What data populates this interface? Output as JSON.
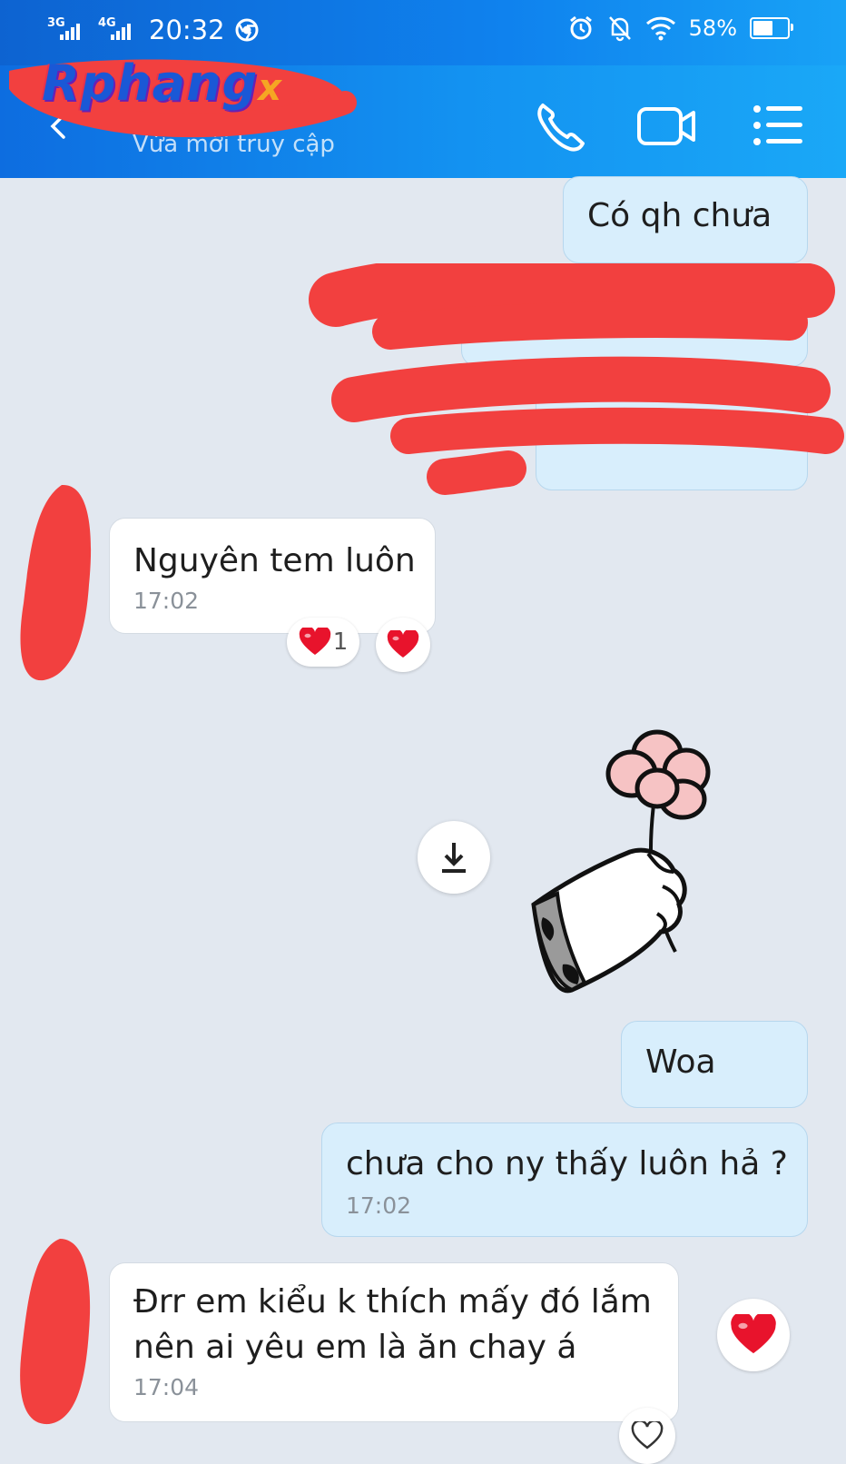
{
  "status_bar": {
    "sim1": "3G",
    "sim2": "4G",
    "time": "20:32",
    "battery_percent": "58%",
    "battery_level": 0.58
  },
  "header": {
    "contact_status": "Vừa mới truy cập",
    "brand_watermark": "Rphang",
    "brand_watermark_x": "x",
    "icons": [
      "back-icon",
      "phone-icon",
      "video-call-icon",
      "menu-icon"
    ]
  },
  "messages": [
    {
      "side": "out",
      "text": "Có qh chưa"
    },
    {
      "side": "in",
      "text": "Nguyên tem luôn",
      "time": "17:02",
      "reactions": [
        {
          "emoji": "heart",
          "count": "1"
        }
      ]
    },
    {
      "side": "out",
      "text": "Woa"
    },
    {
      "side": "out",
      "text": "chưa cho ny thấy luôn hả ?",
      "time": "17:02"
    },
    {
      "side": "in",
      "lines": [
        "Đrr em kiểu k thích mấy đó lắm",
        "nên ai yêu em là ăn chay á"
      ],
      "time": "17:04"
    }
  ],
  "colors": {
    "header": "#1392f1",
    "outgoing_bubble": "#d8eefc",
    "incoming_bubble": "#ffffff",
    "chat_background": "#e2e8f0",
    "redaction": "#f2403f",
    "heart": "#e8132c"
  }
}
